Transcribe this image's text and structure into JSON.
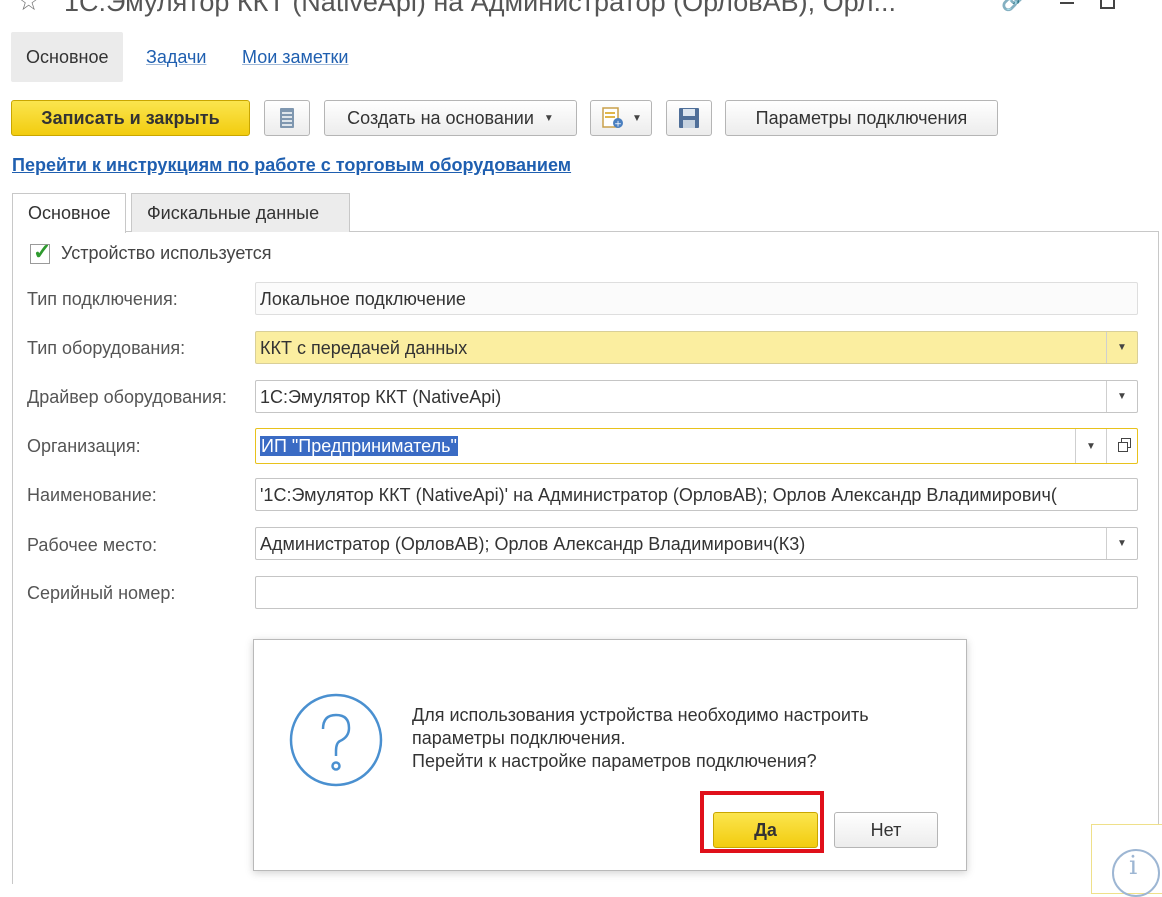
{
  "window": {
    "title": "1С:Эмулятор ККТ (NativeApi) на Администратор (ОрловАВ), Орл..."
  },
  "nav": {
    "items": [
      "Основное",
      "Задачи",
      "Мои заметки"
    ]
  },
  "toolbar": {
    "save_close": "Записать и закрыть",
    "create_based_on": "Создать на основании",
    "connection_params": "Параметры подключения"
  },
  "help_link": "Перейти к инструкциям по работе с торговым оборудованием",
  "tabs": [
    "Основное",
    "Фискальные данные"
  ],
  "form": {
    "device_used": {
      "label": "Устройство используется",
      "checked": true
    },
    "connection_type": {
      "label": "Тип подключения:",
      "value": "Локальное подключение"
    },
    "equipment_type": {
      "label": "Тип оборудования:",
      "value": "ККТ с передачей данных"
    },
    "driver": {
      "label": "Драйвер оборудования:",
      "value": "1С:Эмулятор ККТ (NativeApi)"
    },
    "organization": {
      "label": "Организация:",
      "value": "ИП \"Предприниматель\""
    },
    "name": {
      "label": "Наименование:",
      "value": "'1С:Эмулятор ККТ (NativeApi)' на Администратор (ОрловАВ); Орлов Александр Владимирович("
    },
    "workplace": {
      "label": "Рабочее место:",
      "value": "Администратор (ОрловАВ); Орлов Александр Владимирович(К3)"
    },
    "serial": {
      "label": "Серийный номер:",
      "value": ""
    }
  },
  "dialog": {
    "line1": "Для использования устройства необходимо настроить",
    "line2": "параметры подключения.",
    "line3": "Перейти к настройке параметров подключения?",
    "yes": "Да",
    "no": "Нет"
  },
  "colors": {
    "accent_yellow": "#f2cc0f",
    "link_blue": "#1f5fb0",
    "highlight_red": "#e0101a",
    "question_icon_blue": "#4a90d0"
  },
  "icons": [
    "star-icon",
    "link-icon",
    "list-icon",
    "document-add-icon",
    "save-disk-icon",
    "question-icon",
    "info-icon"
  ]
}
